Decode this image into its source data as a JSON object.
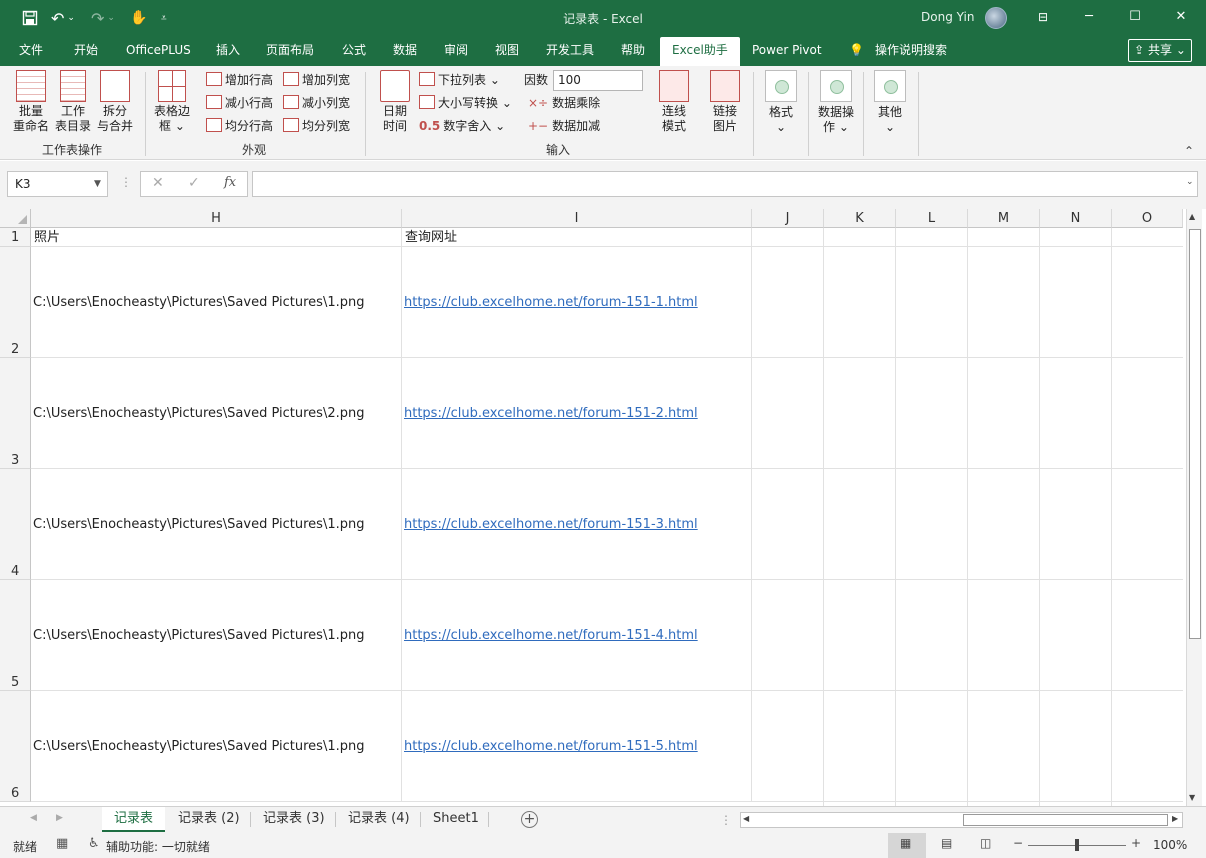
{
  "window": {
    "title": "记录表  -  Excel",
    "user": "Dong Yin"
  },
  "tabs": [
    "文件",
    "开始",
    "OfficePLUS",
    "插入",
    "页面布局",
    "公式",
    "数据",
    "审阅",
    "视图",
    "开发工具",
    "帮助",
    "Excel助手",
    "Power Pivot",
    "操作说明搜索"
  ],
  "share_label": "共享",
  "ribbon": {
    "group1": {
      "label": "工作表操作",
      "btn1": "批量重命名",
      "btn1a": "批量",
      "btn1b": "重命名",
      "btn2a": "工作",
      "btn2b": "表目录",
      "btn3a": "拆分",
      "btn3b": "与合并"
    },
    "group2": {
      "label": "外观",
      "border_a": "表格边",
      "border_b": "框",
      "row_add": "增加行高",
      "row_sub": "减小行高",
      "row_even": "均分行高",
      "col_add": "增加列宽",
      "col_sub": "减小列宽",
      "col_even": "均分列宽"
    },
    "group3": {
      "label": "输入",
      "date_a": "日期",
      "date_b": "时间",
      "dropdown": "下拉列表",
      "case": "大小写转换",
      "round": "数字舍入",
      "factor_label": "因数",
      "factor_value": "100",
      "mul": "数据乘除",
      "add": "数据加减",
      "link_a": "连线",
      "link_b": "模式",
      "img_a": "链接",
      "img_b": "图片"
    },
    "group4": {
      "format": "格式",
      "dataop_a": "数据操",
      "dataop_b": "作",
      "other": "其他"
    }
  },
  "formula": {
    "namebox": "K3",
    "content": ""
  },
  "columns": [
    "H",
    "I",
    "J",
    "K",
    "L",
    "M",
    "N",
    "O"
  ],
  "rows": [
    {
      "num": "1",
      "h": "照片",
      "i": "查询网址"
    },
    {
      "num": "2",
      "h": "C:\\Users\\Enocheasty\\Pictures\\Saved Pictures\\1.png",
      "i": "https://club.excelhome.net/forum-151-1.html"
    },
    {
      "num": "3",
      "h": "C:\\Users\\Enocheasty\\Pictures\\Saved Pictures\\2.png",
      "i": "https://club.excelhome.net/forum-151-2.html"
    },
    {
      "num": "4",
      "h": "C:\\Users\\Enocheasty\\Pictures\\Saved Pictures\\1.png",
      "i": "https://club.excelhome.net/forum-151-3.html"
    },
    {
      "num": "5",
      "h": "C:\\Users\\Enocheasty\\Pictures\\Saved Pictures\\1.png",
      "i": "https://club.excelhome.net/forum-151-4.html"
    },
    {
      "num": "6",
      "h": "C:\\Users\\Enocheasty\\Pictures\\Saved Pictures\\1.png",
      "i": "https://club.excelhome.net/forum-151-5.html"
    }
  ],
  "sheets": [
    "记录表",
    "记录表 (2)",
    "记录表 (3)",
    "记录表 (4)",
    "Sheet1"
  ],
  "status": {
    "ready": "就绪",
    "accessibility": "辅助功能: 一切就绪",
    "zoom": "100%"
  },
  "colors": {
    "accent": "#1e6e42",
    "link": "#2f6bbd"
  }
}
